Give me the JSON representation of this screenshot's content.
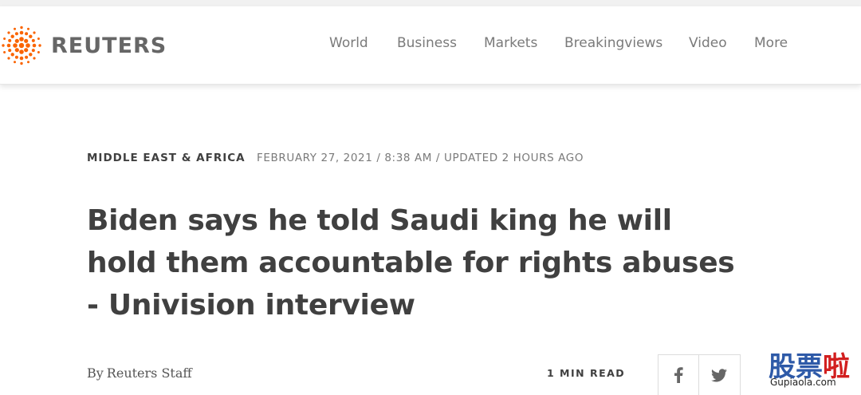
{
  "header": {
    "logo_text": "REUTERS",
    "nav": [
      "World",
      "Business",
      "Markets",
      "Breakingviews",
      "Video",
      "More"
    ]
  },
  "article": {
    "section": "MIDDLE EAST & AFRICA",
    "dateline": "FEBRUARY 27, 2021 / 8:38 AM / UPDATED 2 HOURS AGO",
    "headline": "Biden says he told Saudi king he will hold them accountable for rights abuses - Univision interview",
    "byline_prefix": "By",
    "byline_author": "Reuters Staff",
    "read_time": "1 MIN READ",
    "share_icons": [
      "facebook-icon",
      "twitter-icon"
    ]
  },
  "watermark": {
    "char1": "股",
    "char2": "票",
    "char3": "啦",
    "url": "Gupiaola.com"
  },
  "colors": {
    "brand_orange": "#fa6400",
    "nav_text": "#7a7a7a",
    "headline_text": "#404040"
  }
}
